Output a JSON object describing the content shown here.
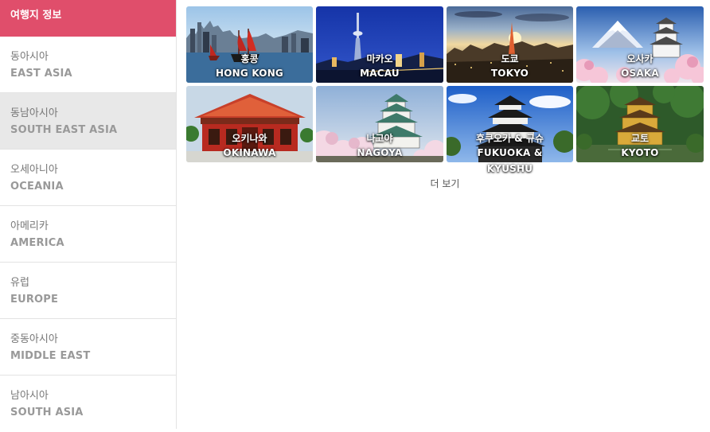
{
  "sidebar": {
    "header": "여행지 정보",
    "items": [
      {
        "ko": "동아시아",
        "en": "EAST ASIA",
        "selected": false
      },
      {
        "ko": "동남아시아",
        "en": "SOUTH EAST ASIA",
        "selected": true
      },
      {
        "ko": "오세아니아",
        "en": "OCEANIA",
        "selected": false
      },
      {
        "ko": "아메리카",
        "en": "AMERICA",
        "selected": false
      },
      {
        "ko": "유럽",
        "en": "EUROPE",
        "selected": false
      },
      {
        "ko": "중동아시아",
        "en": "MIDDLE EAST",
        "selected": false
      },
      {
        "ko": "남아시아",
        "en": "SOUTH ASIA",
        "selected": false
      }
    ]
  },
  "destinations": [
    {
      "ko": "홍콩",
      "en": "HONG KONG",
      "icon": "hong-kong-harbor-photo"
    },
    {
      "ko": "마카오",
      "en": "MACAU",
      "icon": "macau-tower-photo"
    },
    {
      "ko": "도쿄",
      "en": "TOKYO",
      "icon": "tokyo-skyline-photo"
    },
    {
      "ko": "오사카",
      "en": "OSAKA",
      "icon": "osaka-castle-photo"
    },
    {
      "ko": "오키나와",
      "en": "OKINAWA",
      "icon": "okinawa-temple-photo"
    },
    {
      "ko": "나고야",
      "en": "NAGOYA",
      "icon": "nagoya-castle-photo"
    },
    {
      "ko": "후쿠오카 & 규슈",
      "en": "FUKUOKA & KYUSHU",
      "icon": "fukuoka-castle-photo"
    },
    {
      "ko": "교토",
      "en": "KYOTO",
      "icon": "kyoto-golden-pavilion-photo"
    }
  ],
  "more_label": "더 보기",
  "colors": {
    "accent": "#e04e6b",
    "selected_bg": "#e8e8e8"
  }
}
